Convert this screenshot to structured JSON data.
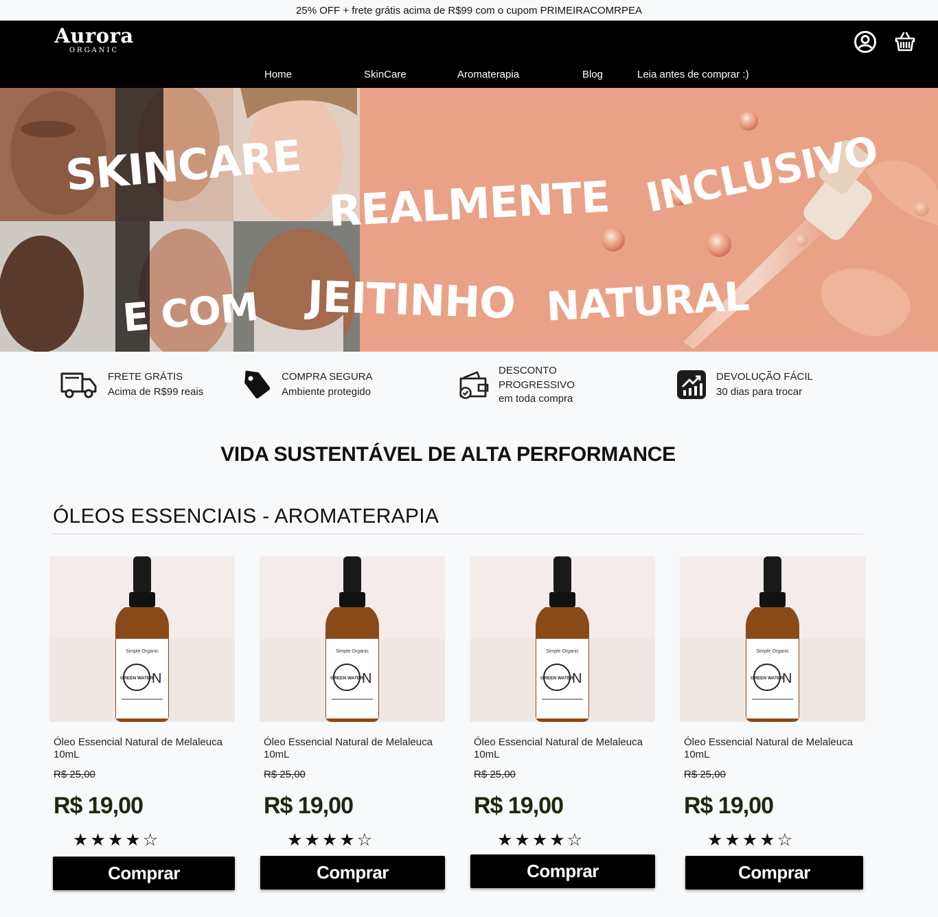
{
  "promo": {
    "text": "25% OFF + frete grátis acima de R$99 com o cupom PRIMEIRACOMRPEA"
  },
  "header": {
    "logo_main": "Aurora",
    "logo_sub": "ORGANIC",
    "nav": [
      "Home",
      "SkinCare",
      "Aromaterapia",
      "Blog",
      "Leia antes de comprar :)"
    ],
    "icons": [
      "user-account-icon",
      "basket-icon"
    ]
  },
  "hero": {
    "words": [
      "SKINCARE",
      "REALMENTE",
      "INCLUSIVO",
      "E COM",
      "JEITINHO",
      "NATURAL"
    ]
  },
  "features": [
    {
      "icon": "truck-icon",
      "title": "FRETE GRÁTIS",
      "lines": [
        "Acima de R$99 reais"
      ]
    },
    {
      "icon": "tag-icon",
      "title": "COMPRA SEGURA",
      "lines": [
        "Ambiente protegido"
      ]
    },
    {
      "icon": "wallet-check-icon",
      "title": "DESCONTO",
      "lines": [
        "PROGRESSIVO",
        "em toda compra"
      ]
    },
    {
      "icon": "chart-up-icon",
      "title": "DEVOLUÇÃO FÁCIL",
      "lines": [
        "30 dias para trocar"
      ]
    }
  ],
  "tagline": "VIDA SUSTENTÁVEL DE ALTA PERFORMANCE",
  "section": {
    "title": "ÓLEOS ESSENCIAIS - AROMATERAPIA"
  },
  "products": [
    {
      "name": "Óleo Essencial Natural de Melaleuca 10mL",
      "old_price": "R$ 25,00",
      "price": "R$ 19,00",
      "rating": 4,
      "stars": "★★★★☆",
      "button": "Comprar",
      "label_brand": "Simple Organic",
      "label_name": "GREEN WATER",
      "label_letter": "N"
    },
    {
      "name": "Óleo Essencial Natural de Melaleuca 10mL",
      "old_price": "R$ 25,00",
      "price": "R$ 19,00",
      "rating": 4,
      "stars": "★★★★☆",
      "button": "Comprar",
      "label_brand": "Simple Organic",
      "label_name": "GREEN WATER",
      "label_letter": "N"
    },
    {
      "name": "Óleo Essencial Natural de Melaleuca 10mL",
      "old_price": "R$ 25,00",
      "price": "R$ 19,00",
      "rating": 4,
      "stars": "★★★★☆",
      "button": "Comprar",
      "label_brand": "Simple Organic",
      "label_name": "GREEN WATER",
      "label_letter": "N"
    },
    {
      "name": "Óleo Essencial Natural de Melaleuca 10mL",
      "old_price": "R$ 25,00",
      "price": "R$ 19,00",
      "rating": 4,
      "stars": "★★★★☆",
      "button": "Comprar",
      "label_brand": "Simple Organic",
      "label_name": "GREEN WATER",
      "label_letter": "N"
    }
  ],
  "colors": {
    "header_bg": "#000000",
    "page_bg": "#f8f9fb",
    "hero_bg": "#e9a287",
    "price": "#1b2a10",
    "button_bg": "#000000"
  }
}
